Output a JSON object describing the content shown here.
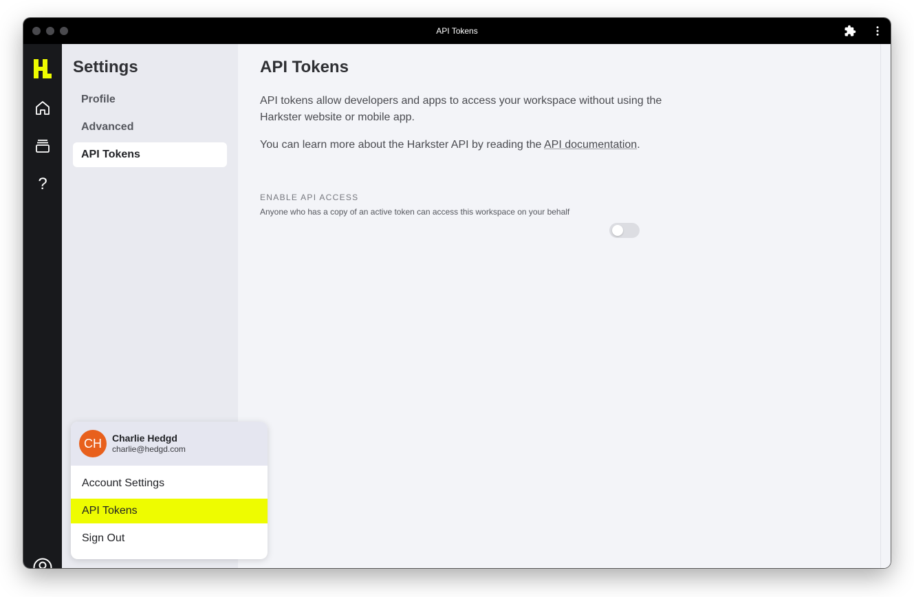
{
  "window": {
    "title": "API Tokens"
  },
  "sidebar": {
    "title": "Settings",
    "items": [
      {
        "label": "Profile"
      },
      {
        "label": "Advanced"
      },
      {
        "label": "API Tokens"
      }
    ]
  },
  "main": {
    "title": "API Tokens",
    "para1": "API tokens allow developers and apps to access your workspace without using the Harkster website or mobile app.",
    "para2_prefix": "You can learn more about the Harkster API by reading the ",
    "para2_link": "API documentation",
    "para2_suffix": ".",
    "api_access": {
      "label": "ENABLE API ACCESS",
      "description": "Anyone who has a copy of an active token can access this workspace on your behalf",
      "enabled": false
    }
  },
  "rail": {
    "icons": [
      "harkster-logo-icon",
      "home-icon",
      "stack-icon",
      "help-icon",
      "user-circle-icon"
    ],
    "help_glyph": "?"
  },
  "user_menu": {
    "initials": "CH",
    "name": "Charlie Hedgd",
    "email": "charlie@hedgd.com",
    "items": [
      {
        "label": "Account Settings"
      },
      {
        "label": "API Tokens"
      },
      {
        "label": "Sign Out"
      }
    ]
  },
  "colors": {
    "brand_yellow": "#eefc00",
    "avatar_orange": "#e8601c",
    "rail_bg": "#18191c"
  }
}
